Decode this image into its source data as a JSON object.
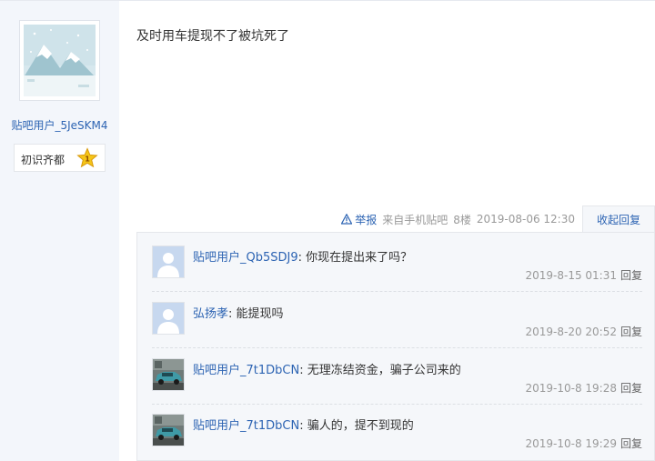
{
  "author": {
    "username": "贴吧用户_5JeSKM4",
    "level_name": "初识齐都",
    "level_number": "1",
    "avatar_icon": "snowy-mountain-avatar"
  },
  "post": {
    "content": "及时用车提现不了被坑死了",
    "report_label": "举报",
    "source": "来自手机贴吧",
    "floor": "8楼",
    "datetime": "2019-08-06 12:30",
    "collapse_label": "收起回复"
  },
  "replies": [
    {
      "user": "贴吧用户_Qb5SDJ9",
      "text": ": 你现在提出来了吗？",
      "time": "2019-8-15 01:31",
      "reply_label": "回复",
      "avatar_icon": "default-avatar"
    },
    {
      "user": "弘扬孝",
      "text": ": 能提现吗",
      "time": "2019-8-20 20:52",
      "reply_label": "回复",
      "avatar_icon": "default-avatar"
    },
    {
      "user": "贴吧用户_7t1DbCN",
      "text": ": 无理冻结资金，骗子公司来的",
      "time": "2019-10-8 19:28",
      "reply_label": "回复",
      "avatar_icon": "car-photo-avatar"
    },
    {
      "user": "贴吧用户_7t1DbCN",
      "text": ": 骗人的，提不到现的",
      "time": "2019-10-8 19:29",
      "reply_label": "回复",
      "avatar_icon": "car-photo-avatar"
    }
  ],
  "colors": {
    "link": "#2d64b3",
    "sidebar_bg": "#f3f6fb",
    "reply_bg": "#f5f7fa",
    "star": "#f5c518"
  }
}
